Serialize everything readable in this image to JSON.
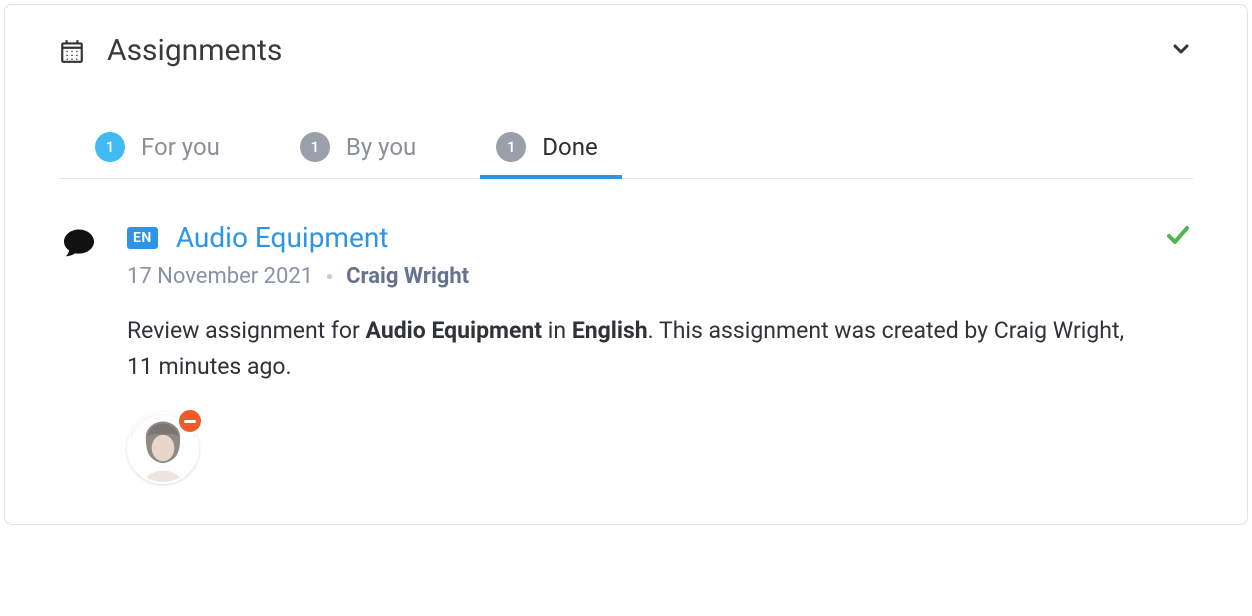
{
  "header": {
    "title": "Assignments"
  },
  "tabs": [
    {
      "count": "1",
      "label": "For you",
      "active": false,
      "primary": true
    },
    {
      "count": "1",
      "label": "By you",
      "active": false,
      "primary": false
    },
    {
      "count": "1",
      "label": "Done",
      "active": true,
      "primary": false
    }
  ],
  "item": {
    "lang": "EN",
    "title": "Audio Equipment",
    "date": "17 November 2021",
    "author": "Craig Wright",
    "desc_prefix": "Review assignment for ",
    "desc_topic": "Audio Equipment",
    "desc_in": " in ",
    "desc_lang": "English",
    "desc_suffix": ". This assignment was created by Craig Wright, 11 minutes ago."
  }
}
